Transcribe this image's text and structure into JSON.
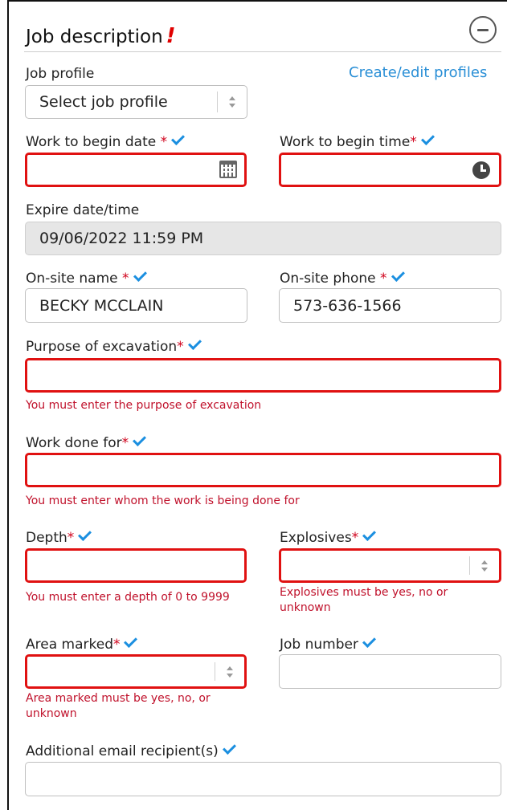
{
  "section": {
    "title": "Job description",
    "alert_mark": "!",
    "create_link": "Create/edit profiles"
  },
  "job_profile": {
    "label": "Job profile",
    "value": "Select job profile"
  },
  "begin_date": {
    "label": "Work to begin date",
    "req": "*",
    "value": ""
  },
  "begin_time": {
    "label": "Work to begin time",
    "req": "*",
    "value": ""
  },
  "expire": {
    "label": "Expire date/time",
    "value": "09/06/2022 11:59 PM"
  },
  "onsite_name": {
    "label": "On-site name",
    "req": "*",
    "value": "BECKY MCCLAIN"
  },
  "onsite_phone": {
    "label": "On-site phone",
    "req": "*",
    "value": "573-636-1566"
  },
  "purpose": {
    "label": "Purpose of excavation",
    "req": "*",
    "value": "",
    "error": "You must enter the purpose of excavation"
  },
  "done_for": {
    "label": "Work done for",
    "req": "*",
    "value": "",
    "error": "You must enter whom the work is being done for"
  },
  "depth": {
    "label": "Depth",
    "req": "*",
    "value": "",
    "error": "You must enter a depth of 0 to 9999"
  },
  "explosives": {
    "label": "Explosives",
    "req": "*",
    "value": "",
    "error_line1": "Explosives must be yes, no or",
    "error_line2": "unknown"
  },
  "area_marked": {
    "label": "Area marked",
    "req": "*",
    "value": "",
    "error_line1": "Area marked must be yes, no, or",
    "error_line2": "unknown"
  },
  "job_number": {
    "label": "Job number",
    "value": ""
  },
  "email": {
    "label": "Additional email recipient(s)",
    "value": ""
  },
  "colors": {
    "error": "#e01111",
    "check": "#1b8fe0",
    "link": "#2a8fd6",
    "required": "#d0021b"
  }
}
